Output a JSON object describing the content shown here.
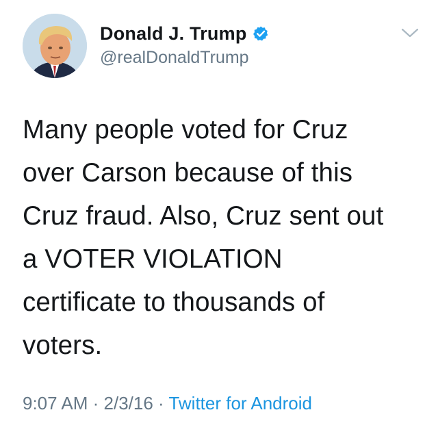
{
  "author": {
    "display_name": "Donald J. Trump",
    "handle": "@realDonaldTrump",
    "verified": true
  },
  "tweet": {
    "text": "Many people voted for Cruz\nover Carson because of this\nCruz fraud. Also, Cruz sent out\na VOTER VIOLATION\ncertificate to thousands of\nvoters.",
    "time": "9:07 AM",
    "separator": " · ",
    "date": "2/3/16",
    "source": "Twitter for Android"
  },
  "colors": {
    "verified_blue": "#1da1f2",
    "link_blue": "#1b95e0",
    "secondary_gray": "#657786",
    "text_black": "#14171a"
  },
  "icons": {
    "verified": "verified-badge-icon",
    "more": "chevron-down-icon"
  }
}
